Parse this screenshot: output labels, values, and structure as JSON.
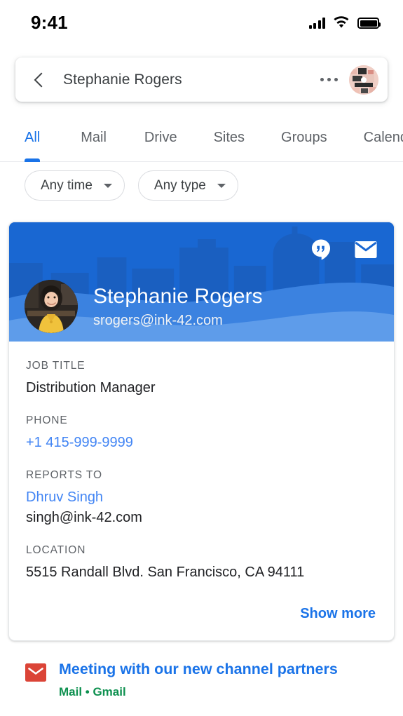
{
  "status_bar": {
    "time": "9:41",
    "signal_icon": "cellular-signal-icon",
    "wifi_icon": "wifi-icon",
    "battery_icon": "battery-full-icon"
  },
  "search_bar": {
    "back_icon": "back-chevron-icon",
    "query": "Stephanie Rogers",
    "overflow_icon": "more-options-icon",
    "account_avatar": "account-avatar"
  },
  "tabs": {
    "items": [
      {
        "label": "All",
        "active": true
      },
      {
        "label": "Mail",
        "active": false
      },
      {
        "label": "Drive",
        "active": false
      },
      {
        "label": "Sites",
        "active": false
      },
      {
        "label": "Groups",
        "active": false
      },
      {
        "label": "Calend",
        "active": false
      }
    ]
  },
  "filters": {
    "chips": [
      {
        "label": "Any time",
        "caret_icon": "chevron-down-icon"
      },
      {
        "label": "Any type",
        "caret_icon": "chevron-down-icon"
      }
    ]
  },
  "contact_card": {
    "header": {
      "chat_icon": "hangouts-chat-icon",
      "mail_icon": "envelope-icon",
      "avatar": "contact-photo",
      "name": "Stephanie Rogers",
      "email": "srogers@ink-42.com"
    },
    "fields": [
      {
        "label": "JOB TITLE",
        "value": "Distribution Manager",
        "link": false,
        "sub": null
      },
      {
        "label": "PHONE",
        "value": "+1 415-999-9999",
        "link": true,
        "sub": null
      },
      {
        "label": "REPORTS TO",
        "value": "Dhruv Singh",
        "link": true,
        "sub": "singh@ink-42.com"
      },
      {
        "label": "LOCATION",
        "value": "5515 Randall Blvd. San Francisco, CA 94111",
        "link": false,
        "sub": null
      }
    ],
    "show_more_label": "Show more"
  },
  "results": [
    {
      "icon": "gmail-icon",
      "title": "Meeting with our new channel partners",
      "meta": "Mail • Gmail"
    }
  ],
  "colors": {
    "accent_blue": "#1a73e8",
    "link_blue": "#4285f4",
    "header_blue": "#1967d2",
    "wave_blue": "#3b82e0",
    "wave_light_blue": "#5e9cea",
    "text_primary": "#202124",
    "text_secondary": "#5f6368",
    "green": "#0d904f",
    "gmail_red": "#db4437"
  }
}
